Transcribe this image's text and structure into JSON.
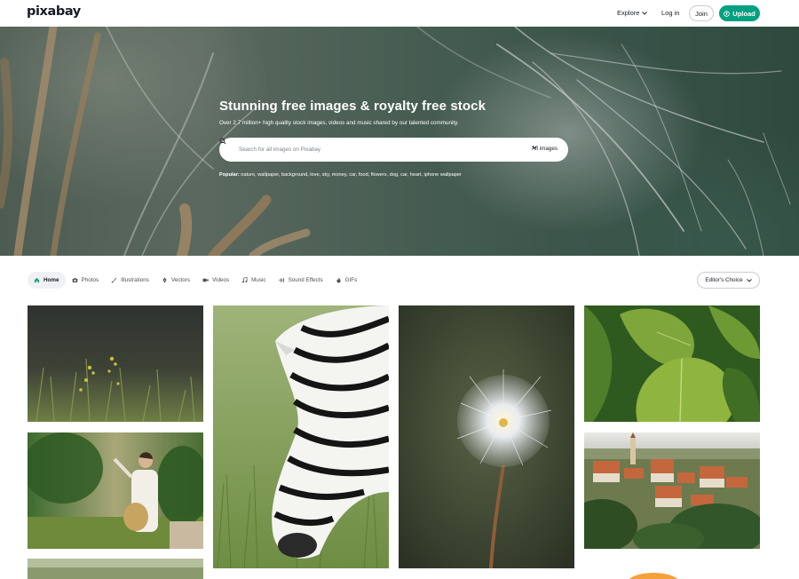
{
  "header": {
    "logo": "pixabay",
    "explore_label": "Explore",
    "login_label": "Log in",
    "join_label": "Join",
    "upload_label": "Upload"
  },
  "hero": {
    "title": "Stunning free images & royalty free stock",
    "subtitle": "Over 2.7 million+ high quality stock images, videos and music shared by our talented community.",
    "search_placeholder": "Search for all images on Pixabay",
    "search_filter": "All images",
    "popular_label": "Popular:",
    "popular_terms": "nature, wallpaper, background, love, sky, money, car, food, flowers, dog, car, heart, iphone wallpaper"
  },
  "categories": [
    {
      "label": "Home",
      "icon": "home-icon",
      "active": true
    },
    {
      "label": "Photos",
      "icon": "camera-icon",
      "active": false
    },
    {
      "label": "Illustrations",
      "icon": "brush-icon",
      "active": false
    },
    {
      "label": "Vectors",
      "icon": "pen-nib-icon",
      "active": false
    },
    {
      "label": "Videos",
      "icon": "video-icon",
      "active": false
    },
    {
      "label": "Music",
      "icon": "music-note-icon",
      "active": false
    },
    {
      "label": "Sound Effects",
      "icon": "waveform-icon",
      "active": false
    },
    {
      "label": "GIFs",
      "icon": "gif-icon",
      "active": false
    }
  ],
  "sort": {
    "label": "Editor's Choice"
  },
  "colors": {
    "brand_green": "#05a081",
    "text": "#191b26",
    "muted": "#4b4f58"
  },
  "photos": [
    {
      "subject": "wildflowers-in-grass"
    },
    {
      "subject": "woman-in-garden-with-straw-hat"
    },
    {
      "subject": "grazing-zebra"
    },
    {
      "subject": "dandelion-seed-head"
    },
    {
      "subject": "green-hosta-leaves"
    },
    {
      "subject": "old-town-river-view"
    }
  ]
}
